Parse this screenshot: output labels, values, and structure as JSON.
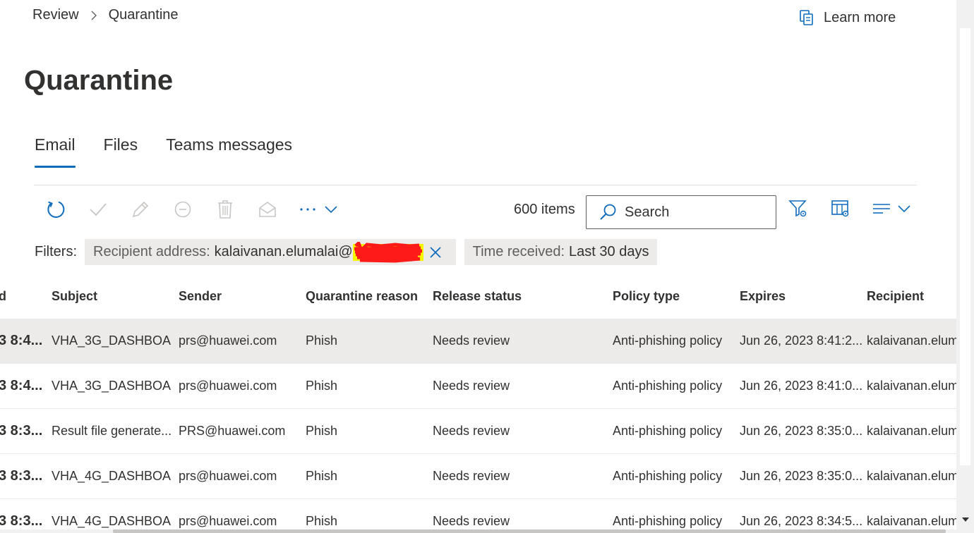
{
  "breadcrumb": {
    "items": [
      "Review",
      "Quarantine"
    ]
  },
  "learn_more": "Learn more",
  "page_title": "Quarantine",
  "tabs": [
    {
      "label": "Email",
      "active": true
    },
    {
      "label": "Files",
      "active": false
    },
    {
      "label": "Teams messages",
      "active": false
    }
  ],
  "toolbar": {
    "icons": [
      "refresh-icon",
      "check-icon",
      "edit-icon",
      "block-icon",
      "delete-icon",
      "envelope-open-icon",
      "more-icon"
    ],
    "items_count": "600 items",
    "search_placeholder": "Search"
  },
  "filters": {
    "label": "Filters:",
    "pills": [
      {
        "key": "Recipient address:",
        "value": "kalaivanan.elumalai@"
      },
      {
        "key": "Time received:",
        "value": "Last 30 days"
      }
    ]
  },
  "table": {
    "columns": [
      "d",
      "Subject",
      "Sender",
      "Quarantine reason",
      "Release status",
      "Policy type",
      "Expires",
      "Recipient"
    ],
    "rows": [
      {
        "time": "3 8:4...",
        "subject": "VHA_3G_DASHBOA...",
        "sender": "prs@huawei.com",
        "reason": "Phish",
        "status": "Needs review",
        "policy": "Anti-phishing policy",
        "expires": "Jun 26, 2023 8:41:2...",
        "recipient": "kalaivanan.elum",
        "selected": true
      },
      {
        "time": "3 8:4...",
        "subject": "VHA_3G_DASHBOA...",
        "sender": "prs@huawei.com",
        "reason": "Phish",
        "status": "Needs review",
        "policy": "Anti-phishing policy",
        "expires": "Jun 26, 2023 8:41:0...",
        "recipient": "kalaivanan.elum",
        "selected": false
      },
      {
        "time": "3 8:3...",
        "subject": "Result file generate...",
        "sender": "PRS@huawei.com",
        "reason": "Phish",
        "status": "Needs review",
        "policy": "Anti-phishing policy",
        "expires": "Jun 26, 2023 8:35:0...",
        "recipient": "kalaivanan.elum",
        "selected": false
      },
      {
        "time": "3 8:3...",
        "subject": "VHA_4G_DASHBOA...",
        "sender": "prs@huawei.com",
        "reason": "Phish",
        "status": "Needs review",
        "policy": "Anti-phishing policy",
        "expires": "Jun 26, 2023 8:35:0...",
        "recipient": "kalaivanan.elum",
        "selected": false
      },
      {
        "time": "3 8:3...",
        "subject": "VHA_4G_DASHBOA...",
        "sender": "prs@huawei.com",
        "reason": "Phish",
        "status": "Needs review",
        "policy": "Anti-phishing policy",
        "expires": "Jun 26, 2023 8:34:5...",
        "recipient": "kalaivanan.elum",
        "selected": false
      }
    ]
  },
  "colors": {
    "accent": "#0f6cbd",
    "icon_active": "#0f6cbd",
    "icon_disabled": "#c8c6c4",
    "selected_row": "#edebe9",
    "redaction": "#ff1a1a",
    "highlight": "#f5f500"
  }
}
